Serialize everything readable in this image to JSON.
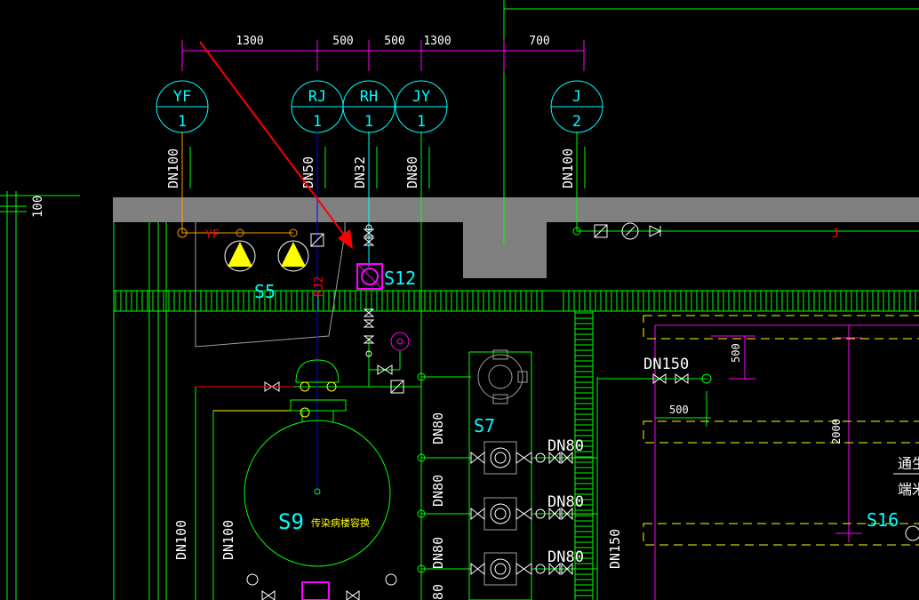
{
  "colors": {
    "background": "#000000",
    "wall": "#808080",
    "green": "#00ff00",
    "magenta": "#ff00ff",
    "cyan": "#00ffff",
    "red": "#ff0000",
    "blue": "#0000ff",
    "yellow": "#ffff00",
    "white": "#ffffff",
    "orange": "#ff9900",
    "pink": "#ff66ff",
    "gray_line": "#a0a0a0"
  },
  "dimensions": {
    "top": [
      "1300",
      "500",
      "500",
      "1300",
      "700"
    ],
    "left_vertical": "100",
    "right_500_vertical": "500",
    "right_500_horizontal": "500",
    "right_2000": "2000"
  },
  "pipes": [
    {
      "code": "YF",
      "num": "1",
      "size": "DN100"
    },
    {
      "code": "RJ",
      "num": "1",
      "size": "DN50"
    },
    {
      "code": "RH",
      "num": "1",
      "size": "DN32"
    },
    {
      "code": "JY",
      "num": "1",
      "size": "DN80"
    },
    {
      "code": "J",
      "num": "2",
      "size": "DN100"
    }
  ],
  "labels": {
    "yf_tag": "YF",
    "j_tag": "J",
    "s5": "S5",
    "s12": "S12",
    "rj2": "RJ2",
    "s7": "S7",
    "s9": "S9",
    "s9_caption": "传染病楼容换",
    "s16": "S16",
    "dn150_horizontal": "DN150",
    "dn150_vertical": "DN150",
    "dn80_pumps": [
      "DN80",
      "DN80",
      "DN80"
    ],
    "dn80_vertical": [
      "DN80",
      "DN80",
      "DN80",
      "80"
    ],
    "dn100_bottom": [
      "DN100",
      "DN100"
    ],
    "right_text_1": "通生",
    "right_text_2": "端米"
  }
}
